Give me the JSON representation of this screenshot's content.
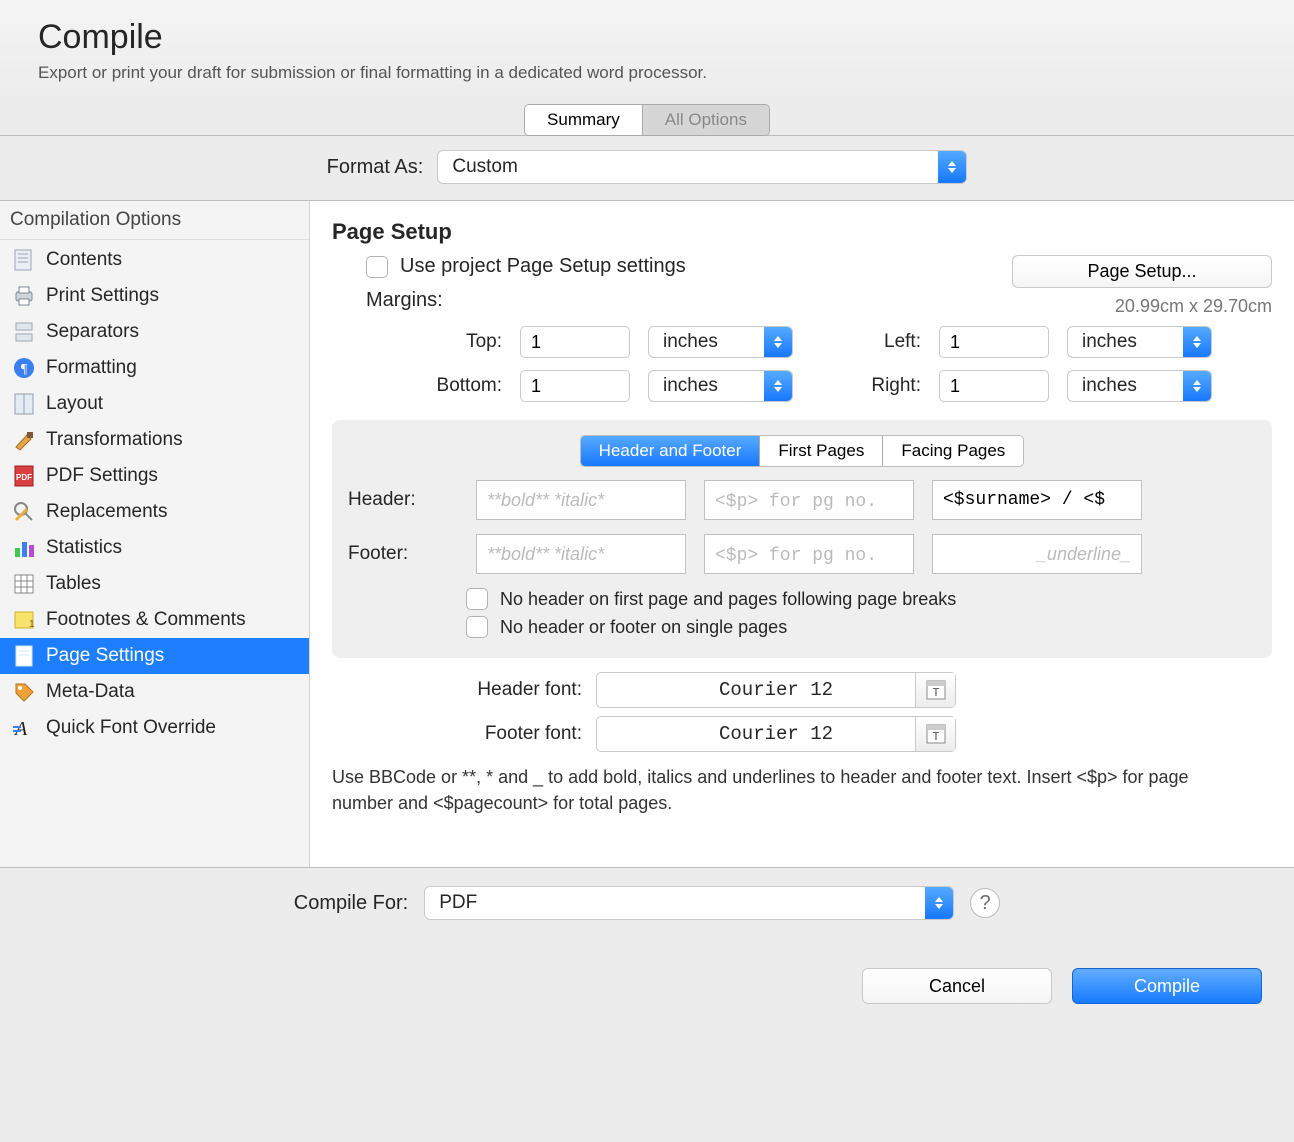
{
  "header": {
    "title": "Compile",
    "subtitle": "Export or print your draft for submission or final formatting in a dedicated word processor."
  },
  "topTabs": {
    "summary": "Summary",
    "allOptions": "All Options"
  },
  "formatAs": {
    "label": "Format As:",
    "value": "Custom"
  },
  "sidebar": {
    "title": "Compilation Options",
    "items": [
      {
        "label": "Contents"
      },
      {
        "label": "Print Settings"
      },
      {
        "label": "Separators"
      },
      {
        "label": "Formatting"
      },
      {
        "label": "Layout"
      },
      {
        "label": "Transformations"
      },
      {
        "label": "PDF Settings"
      },
      {
        "label": "Replacements"
      },
      {
        "label": "Statistics"
      },
      {
        "label": "Tables"
      },
      {
        "label": "Footnotes & Comments"
      },
      {
        "label": "Page Settings",
        "selected": true
      },
      {
        "label": "Meta-Data"
      },
      {
        "label": "Quick Font Override"
      }
    ]
  },
  "pageSetup": {
    "heading": "Page Setup",
    "useProject": "Use project Page Setup settings",
    "pageSetupBtn": "Page Setup...",
    "dims": "20.99cm x 29.70cm",
    "marginsLabel": "Margins:",
    "margins": {
      "topLabel": "Top:",
      "topValue": "1",
      "bottomLabel": "Bottom:",
      "bottomValue": "1",
      "leftLabel": "Left:",
      "leftValue": "1",
      "rightLabel": "Right:",
      "rightValue": "1",
      "unit": "inches"
    },
    "innerTabs": {
      "hf": "Header and Footer",
      "fp": "First Pages",
      "facing": "Facing Pages"
    },
    "hf": {
      "headerLabel": "Header:",
      "footerLabel": "Footer:",
      "p1": "**bold** *italic*",
      "p2": "<$p> for pg no.",
      "headerRight": "<$surname> / <$",
      "p3": "_underline_",
      "noHeaderFirst": "No header on first page and pages following page breaks",
      "noHeaderSingle": "No header or footer on single pages"
    },
    "fonts": {
      "headerLabel": "Header font:",
      "footerLabel": "Footer font:",
      "headerFont": "Courier 12",
      "footerFont": "Courier 12"
    },
    "help": "Use BBCode or **, * and _ to add bold, italics and underlines to header and footer text. Insert <$p> for page number and <$pagecount> for total pages."
  },
  "footer": {
    "compileForLabel": "Compile For:",
    "compileForValue": "PDF",
    "cancel": "Cancel",
    "compile": "Compile"
  }
}
